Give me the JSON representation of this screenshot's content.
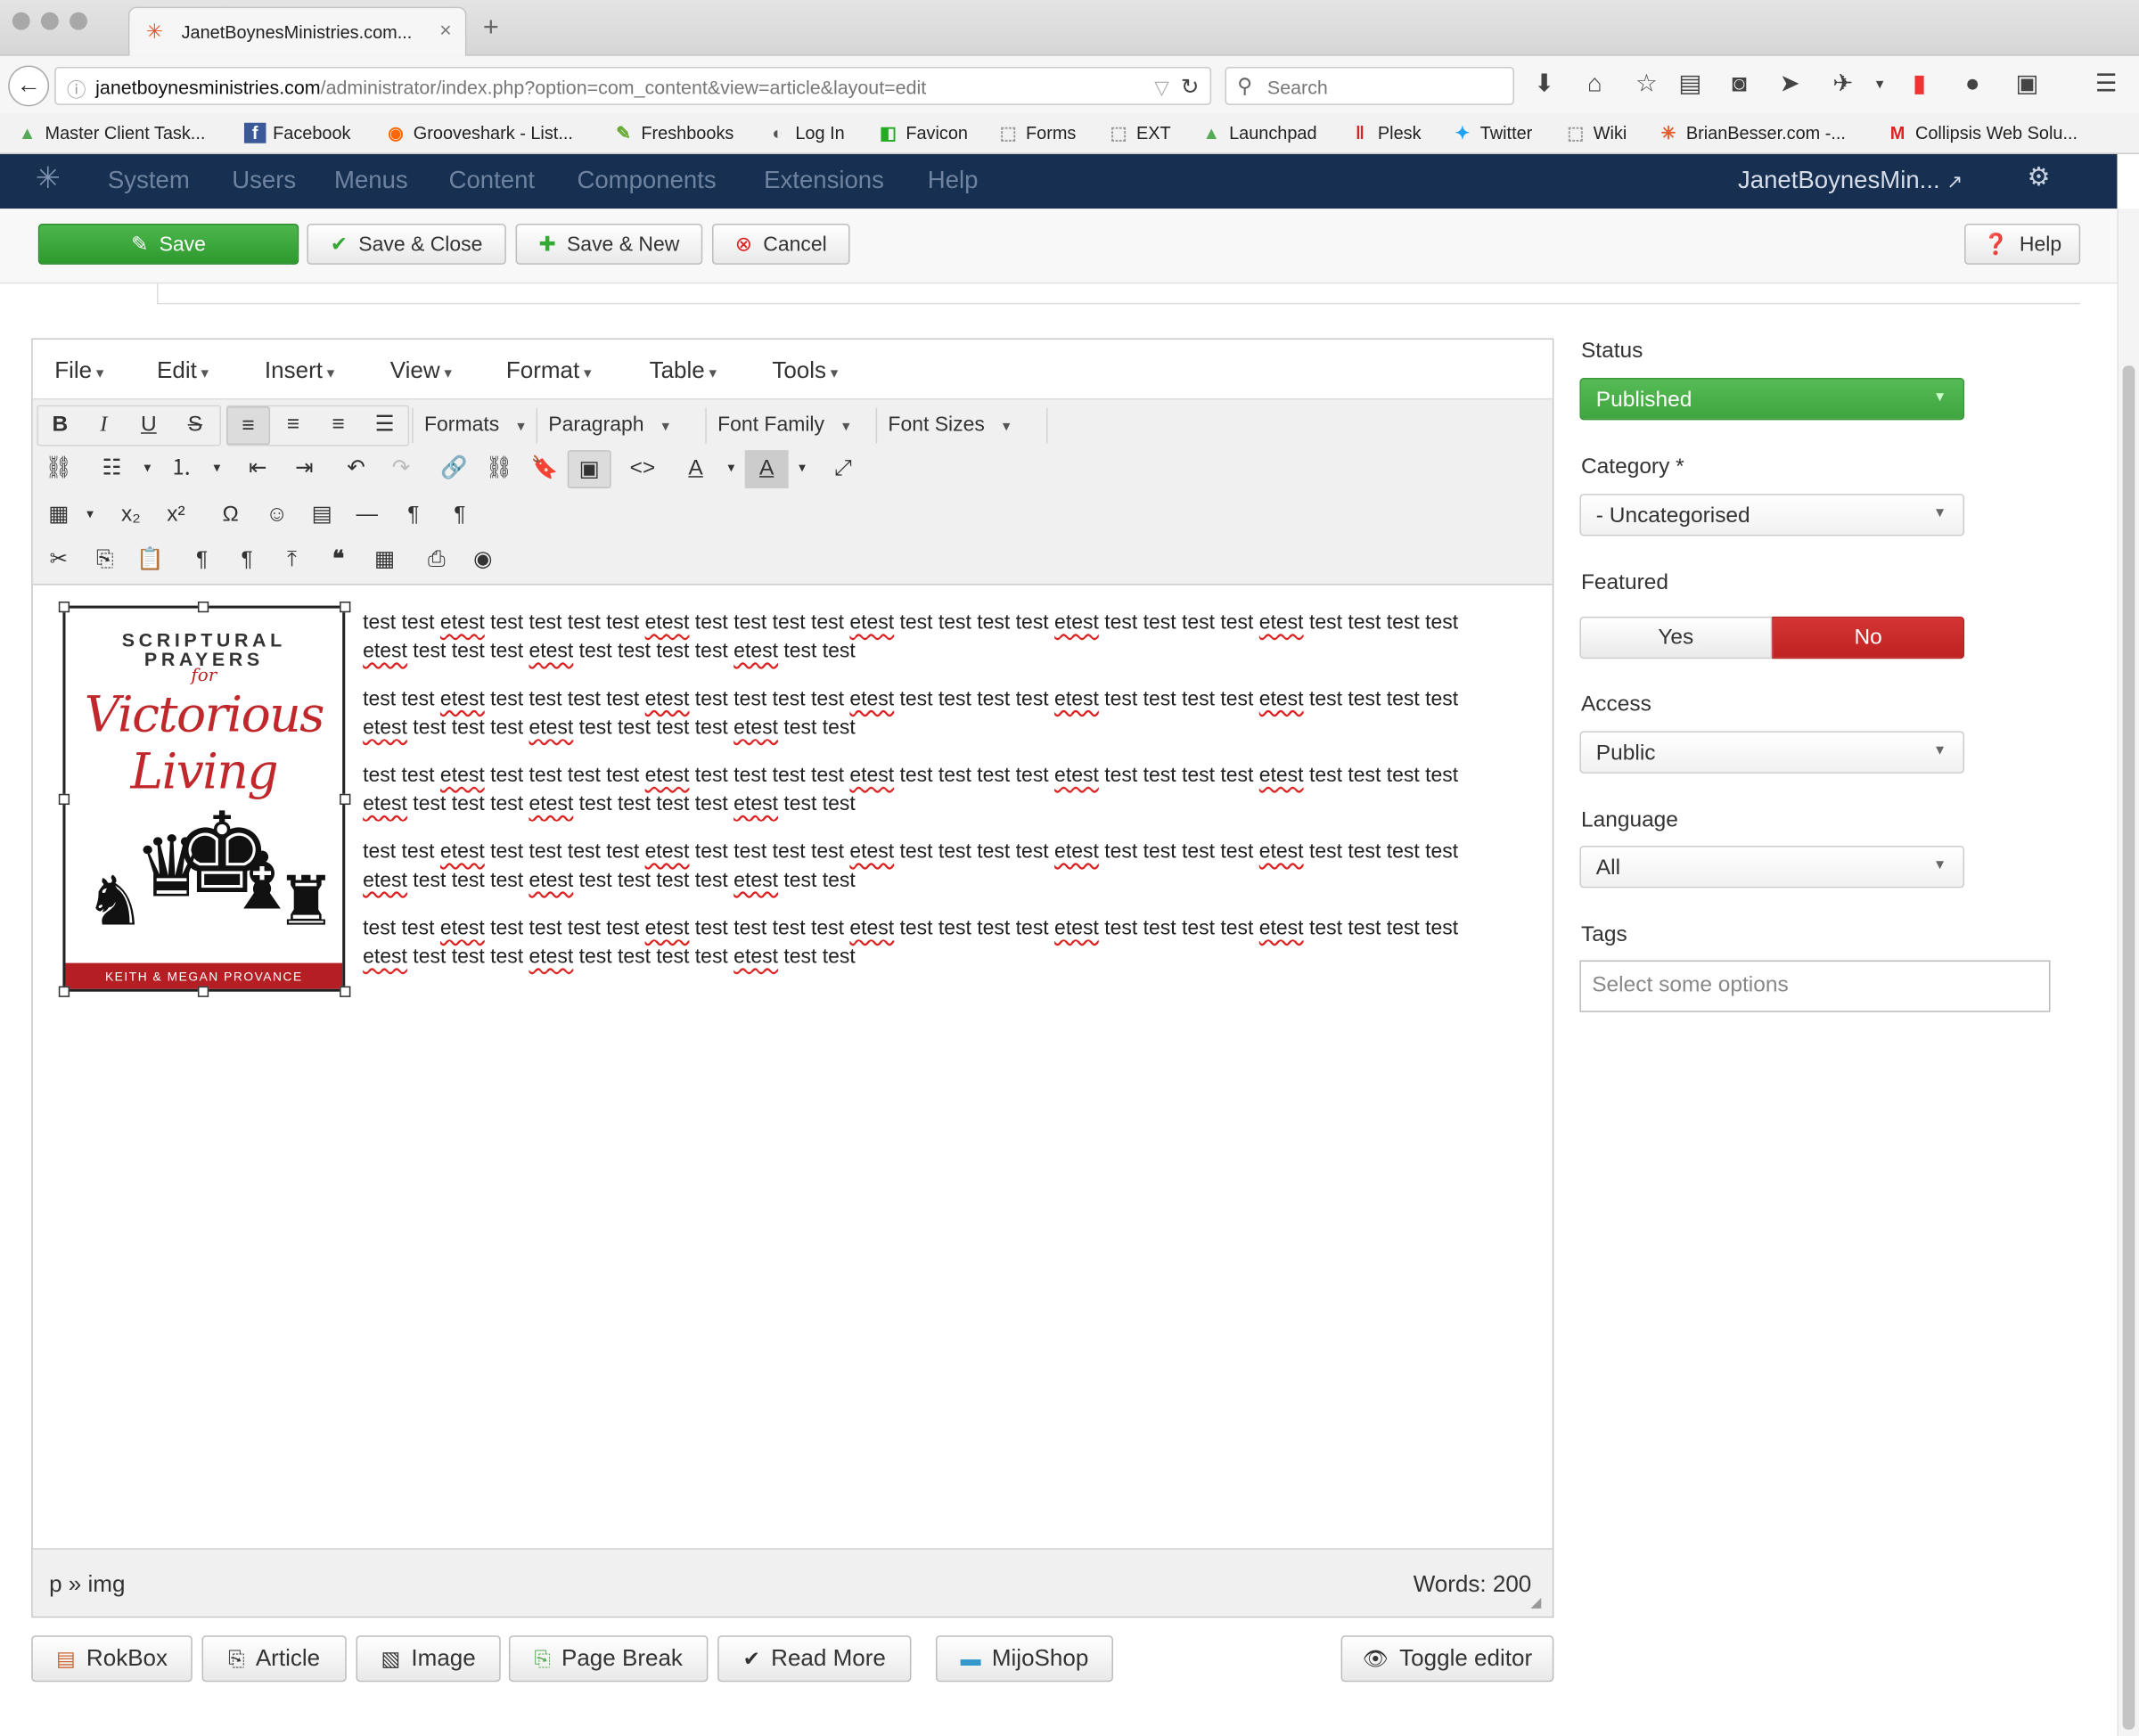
{
  "browser": {
    "tab_title": "JanetBoynesMinistries.com...",
    "tab_close": "×",
    "new_tab": "+",
    "url_domain": "janetboynesministries.com",
    "url_path": "/administrator/index.php?option=com_content&view=article&layout=edit",
    "search_placeholder": "Search",
    "bookmarks": [
      "Master Client Task...",
      "Facebook",
      "Grooveshark - List...",
      "Freshbooks",
      "Log In",
      "Favicon",
      "Forms",
      "EXT",
      "Launchpad",
      "Plesk",
      "Twitter",
      "Wiki",
      "BrianBesser.com -...",
      "Collipsis Web Solu..."
    ]
  },
  "admin": {
    "menu": [
      "System",
      "Users",
      "Menus",
      "Content",
      "Components",
      "Extensions",
      "Help"
    ],
    "site_name": "JanetBoynesMin..."
  },
  "toolbar": {
    "save": "Save",
    "save_close": "Save & Close",
    "save_new": "Save & New",
    "cancel": "Cancel",
    "help": "Help"
  },
  "editor": {
    "menus": [
      "File",
      "Edit",
      "Insert",
      "View",
      "Format",
      "Table",
      "Tools"
    ],
    "formats": "Formats",
    "block": "Paragraph",
    "font_family": "Font Family",
    "font_sizes": "Font Sizes",
    "image": {
      "line1": "SCRIPTURAL",
      "line2": "PRAYERS",
      "line3": "for",
      "title1": "Victorious",
      "title2": "Living",
      "authors": "KEITH & MEGAN PROVANCE"
    },
    "para_line1": [
      "test test ",
      "etest",
      " test test test test ",
      "etest",
      " test test test test ",
      "etest",
      " test test test test ",
      "etest",
      " test test test test ",
      "etest",
      " test test test test"
    ],
    "para_line2": [
      "etest",
      " test test test ",
      "etest",
      " test test test test ",
      "etest",
      " test test"
    ],
    "path": "p » img",
    "word_count": "Words: 200"
  },
  "buttons": [
    "RokBox",
    "Article",
    "Image",
    "Page Break",
    "Read More",
    "MijoShop",
    "Toggle editor"
  ],
  "sidebar": {
    "status_label": "Status",
    "status_value": "Published",
    "category_label": "Category *",
    "category_value": "- Uncategorised",
    "featured_label": "Featured",
    "featured_yes": "Yes",
    "featured_no": "No",
    "access_label": "Access",
    "access_value": "Public",
    "language_label": "Language",
    "language_value": "All",
    "tags_label": "Tags",
    "tags_placeholder": "Select some options"
  },
  "colors": {
    "admin_bar": "#173051",
    "save_green": "#34a034",
    "published_green": "#46b046",
    "no_red": "#c62828"
  }
}
